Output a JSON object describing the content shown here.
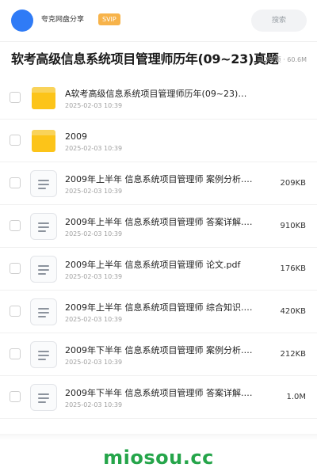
{
  "header": {
    "app_name": "夸克网盘分享",
    "badge": "SVIP",
    "search_label": "搜索",
    "avatar_color": "#2f7bf6"
  },
  "share": {
    "title": "软考高级信息系统项目管理师历年(09~23)真题",
    "meta": "129 项 · 60.6M"
  },
  "files": [
    {
      "type": "folder",
      "icon": "folder-icon",
      "name": "A软考高级信息系统项目管理师历年(09~23)真题",
      "date": "2025-02-03 10:39",
      "size": ""
    },
    {
      "type": "folder",
      "icon": "folder-icon",
      "name": "2009",
      "date": "2025-02-03 10:39",
      "size": ""
    },
    {
      "type": "file",
      "icon": "document-icon",
      "name": "2009年上半年 信息系统项目管理师 案例分析.p…",
      "date": "2025-02-03 10:39",
      "size": "209KB"
    },
    {
      "type": "file",
      "icon": "document-icon",
      "name": "2009年上半年 信息系统项目管理师 答案详解.p…",
      "date": "2025-02-03 10:39",
      "size": "910KB"
    },
    {
      "type": "file",
      "icon": "document-icon",
      "name": "2009年上半年 信息系统项目管理师 论文.pdf",
      "date": "2025-02-03 10:39",
      "size": "176KB"
    },
    {
      "type": "file",
      "icon": "document-icon",
      "name": "2009年上半年 信息系统项目管理师 综合知识.p…",
      "date": "2025-02-03 10:39",
      "size": "420KB"
    },
    {
      "type": "file",
      "icon": "document-icon",
      "name": "2009年下半年 信息系统项目管理师 案例分析.p…",
      "date": "2025-02-03 10:39",
      "size": "212KB"
    },
    {
      "type": "file",
      "icon": "document-icon",
      "name": "2009年下半年 信息系统项目管理师 答案详解.p…",
      "date": "2025-02-03 10:39",
      "size": "1.0M"
    }
  ],
  "watermark": "miosou.cc",
  "colors": {
    "accent": "#2f7bf6",
    "svip": "#f7b34a",
    "folder": "#fcc419",
    "watermark": "#25a54a"
  }
}
